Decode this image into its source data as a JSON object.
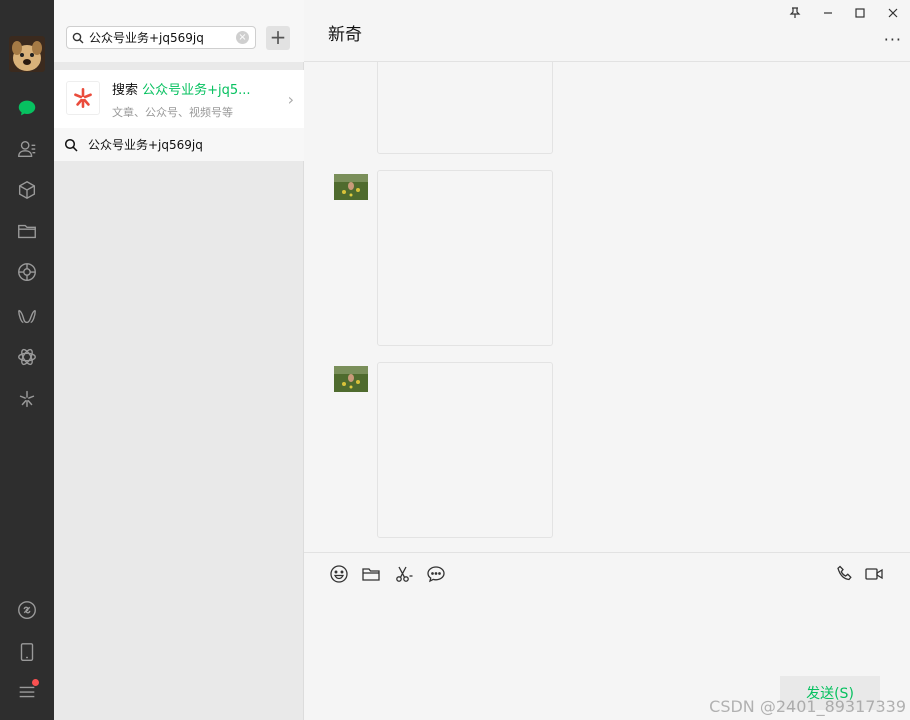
{
  "colors": {
    "brand_green": "#07c160",
    "nav_bg": "#2e2e2e",
    "badge_red": "#fa5151"
  },
  "nav": {
    "items": [
      {
        "icon": "chat-icon",
        "active": true
      },
      {
        "icon": "contacts-icon"
      },
      {
        "icon": "collections-icon"
      },
      {
        "icon": "files-icon"
      },
      {
        "icon": "moments-icon"
      },
      {
        "icon": "channels-icon"
      },
      {
        "icon": "search-feature-icon"
      },
      {
        "icon": "mini-program-icon"
      }
    ],
    "bottom": [
      {
        "icon": "mini-program-panel-icon"
      },
      {
        "icon": "phone-icon"
      },
      {
        "icon": "menu-icon",
        "badge": true
      }
    ]
  },
  "search": {
    "value": "公众号业务+jq569jq",
    "add_label": "+",
    "clear_label": "×",
    "result": {
      "prefix": "搜索 ",
      "keyword": "公众号业务+jq5...",
      "subtitle": "文章、公众号、视频号等",
      "chevron": "›"
    },
    "suggestion": "公众号业务+jq569jq"
  },
  "chat": {
    "title": "新奇",
    "more_label": "···",
    "send_label": "发送(S)"
  },
  "watermark": "CSDN @2401_89317339"
}
